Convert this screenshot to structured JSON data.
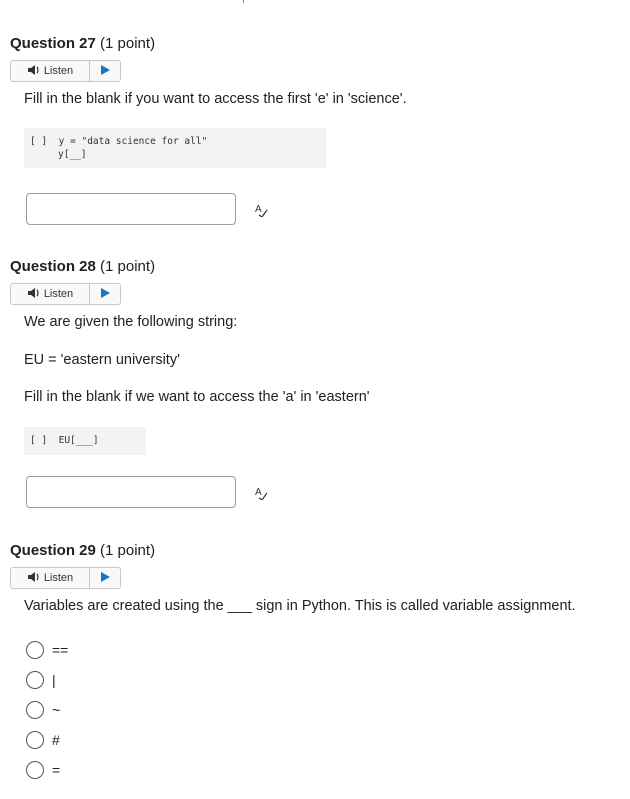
{
  "questions": [
    {
      "number_label": "Question 27",
      "points": "(1 point)",
      "listen_label": "Listen",
      "prompt": "Fill in the blank if you want to access the first 'e' in 'science'.",
      "code_lines": [
        "[ ]  y = \"data science for all\"",
        "y[__]"
      ]
    },
    {
      "number_label": "Question 28",
      "points": "(1 point)",
      "listen_label": "Listen",
      "paragraphs": [
        "We are given the following string:",
        "EU = 'eastern university'",
        "Fill in the blank if we want to access the 'a' in 'eastern'"
      ],
      "code_lines": [
        "[ ]  EU[___]"
      ]
    },
    {
      "number_label": "Question 29",
      "points": "(1 point)",
      "listen_label": "Listen",
      "prompt": "Variables are created using the ___ sign in Python. This is called variable assignment.",
      "options": [
        "==",
        "|",
        "~",
        "#",
        "="
      ]
    }
  ]
}
